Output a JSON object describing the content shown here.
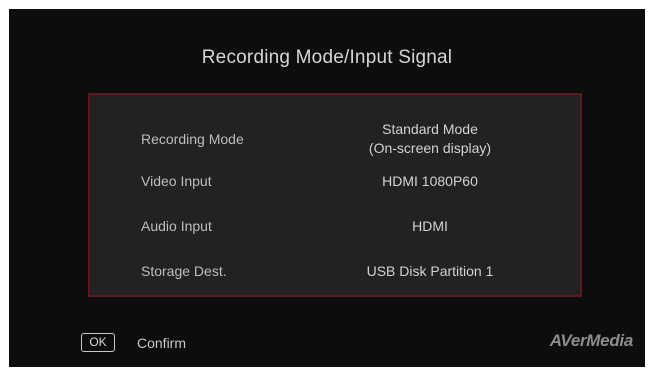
{
  "title": "Recording Mode/Input Signal",
  "settings": [
    {
      "label": "Recording Mode",
      "value_line1": "Standard Mode",
      "value_line2": "(On-screen display)"
    },
    {
      "label": "Video Input",
      "value_line1": "HDMI 1080P60",
      "value_line2": ""
    },
    {
      "label": "Audio Input",
      "value_line1": "HDMI",
      "value_line2": ""
    },
    {
      "label": "Storage Dest.",
      "value_line1": "USB Disk Partition 1",
      "value_line2": ""
    }
  ],
  "footer": {
    "ok_key": "OK",
    "confirm": "Confirm",
    "brand": "AVerMedia"
  },
  "colors": {
    "screen_bg": "#0d0d0d",
    "panel_bg": "#222222",
    "panel_border": "#5a1a1f"
  }
}
